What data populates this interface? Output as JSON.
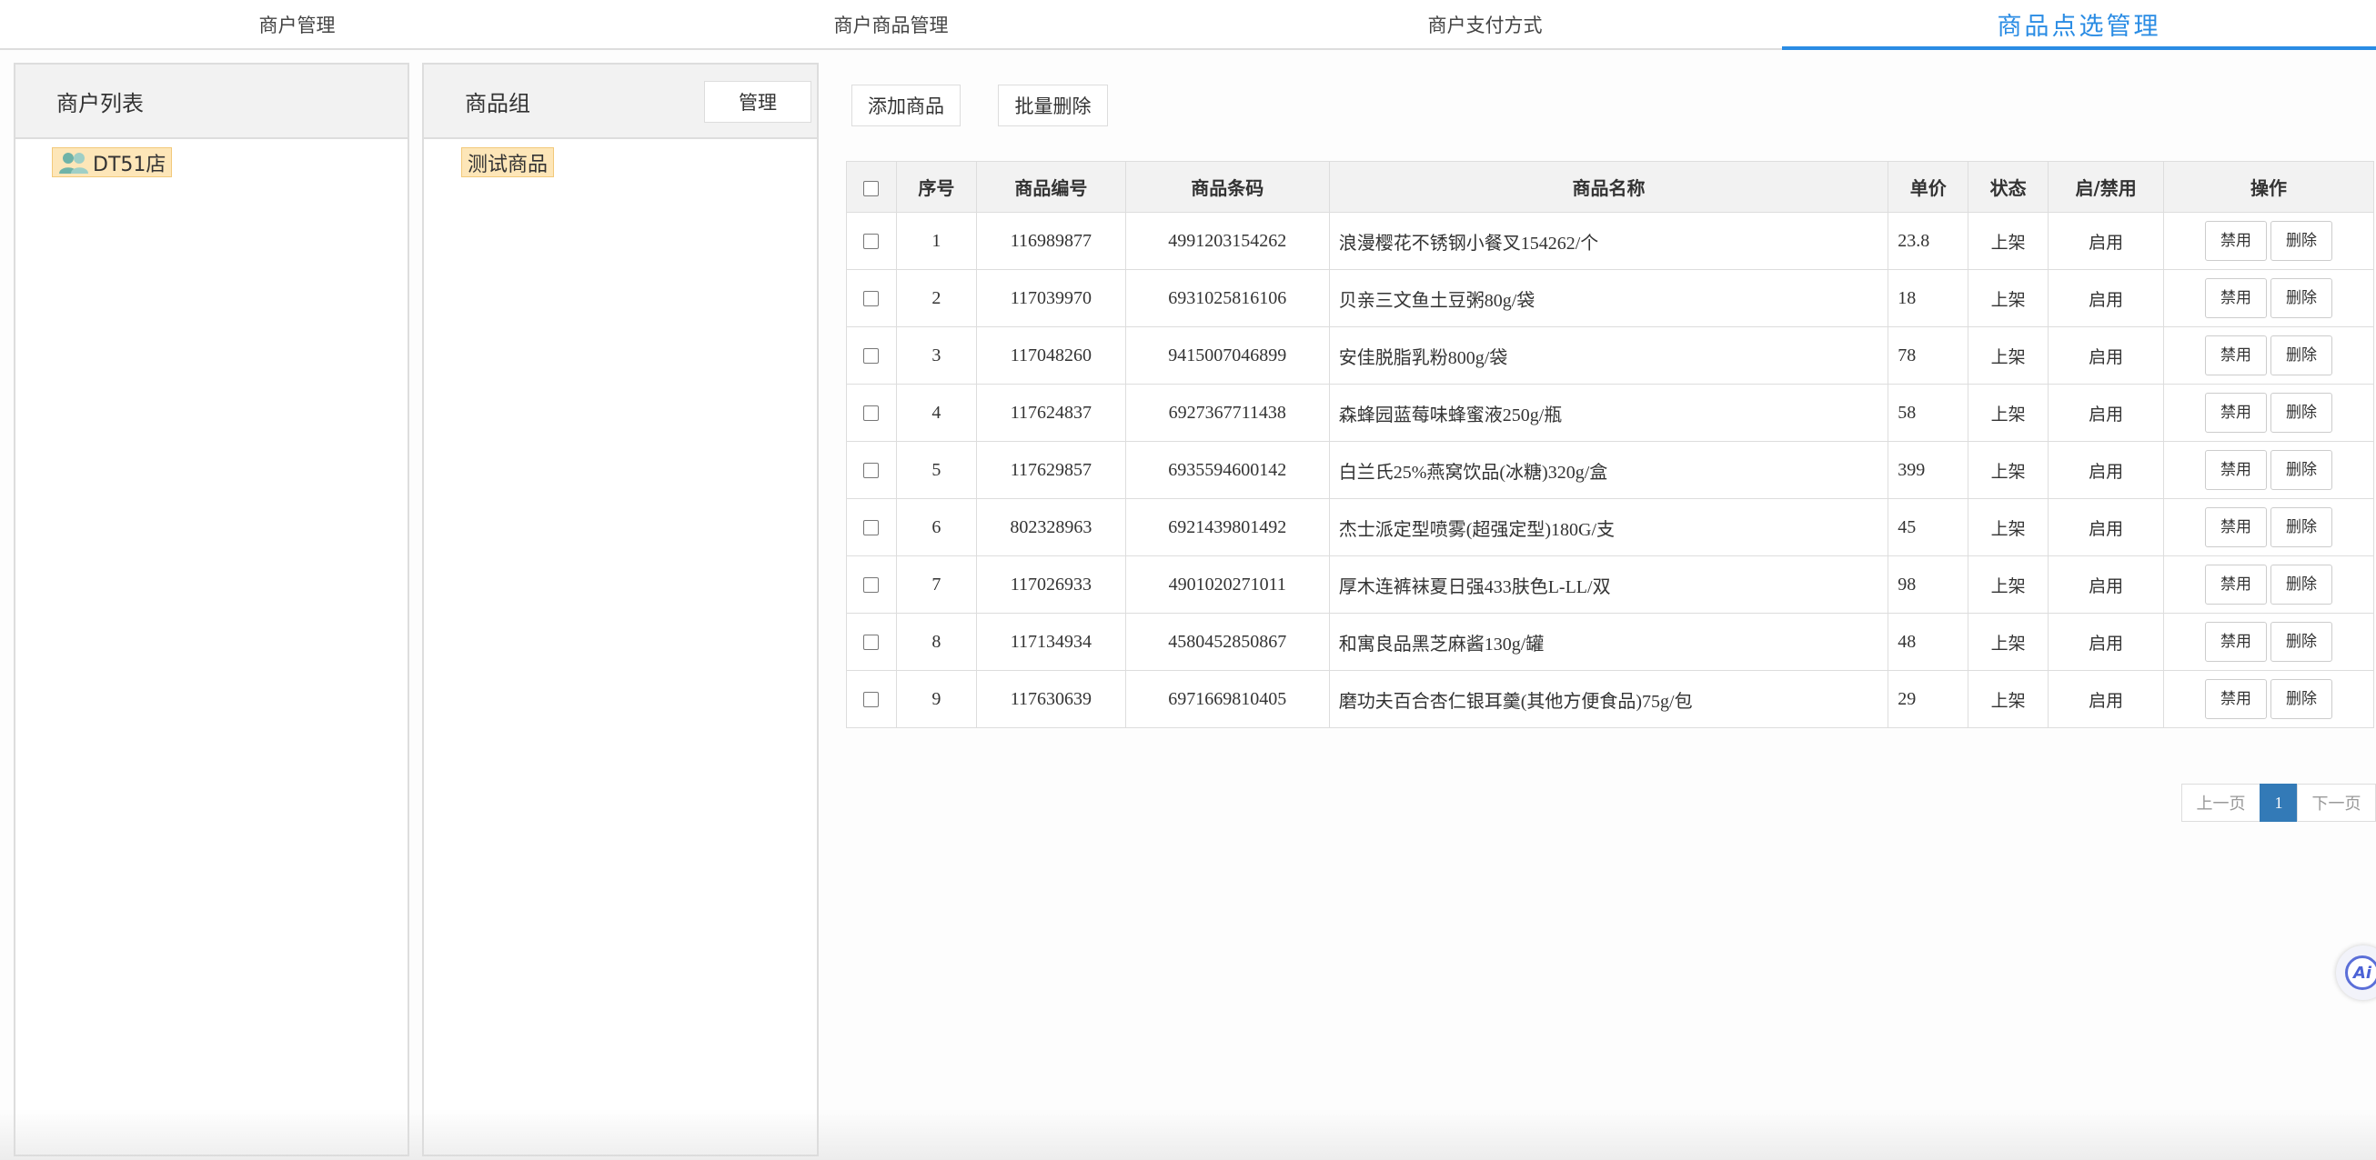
{
  "tabs": [
    {
      "label": "商户管理",
      "active": false
    },
    {
      "label": "商户商品管理",
      "active": false
    },
    {
      "label": "商户支付方式",
      "active": false
    },
    {
      "label": "商品点选管理",
      "active": true
    }
  ],
  "merchant_panel": {
    "title": "商户列表",
    "items": [
      {
        "label": "DT51店",
        "icon": "users-icon"
      }
    ]
  },
  "group_panel": {
    "title": "商品组",
    "manage_label": "管理",
    "items": [
      {
        "label": "测试商品"
      }
    ]
  },
  "toolbar": {
    "add_label": "添加商品",
    "batch_delete_label": "批量删除"
  },
  "table": {
    "columns": [
      "序号",
      "商品编号",
      "商品条码",
      "商品名称",
      "单价",
      "状态",
      "启/禁用",
      "操作"
    ],
    "action_disable": "禁用",
    "action_delete": "删除",
    "rows": [
      {
        "seq": "1",
        "code": "116989877",
        "barcode": "4991203154262",
        "name": "浪漫樱花不锈钢小餐叉154262/个",
        "price": "23.8",
        "status": "上架",
        "enabled": "启用"
      },
      {
        "seq": "2",
        "code": "117039970",
        "barcode": "6931025816106",
        "name": "贝亲三文鱼土豆粥80g/袋",
        "price": "18",
        "status": "上架",
        "enabled": "启用"
      },
      {
        "seq": "3",
        "code": "117048260",
        "barcode": "9415007046899",
        "name": "安佳脱脂乳粉800g/袋",
        "price": "78",
        "status": "上架",
        "enabled": "启用"
      },
      {
        "seq": "4",
        "code": "117624837",
        "barcode": "6927367711438",
        "name": "森蜂园蓝莓味蜂蜜液250g/瓶",
        "price": "58",
        "status": "上架",
        "enabled": "启用"
      },
      {
        "seq": "5",
        "code": "117629857",
        "barcode": "6935594600142",
        "name": "白兰氏25%燕窝饮品(冰糖)320g/盒",
        "price": "399",
        "status": "上架",
        "enabled": "启用"
      },
      {
        "seq": "6",
        "code": "802328963",
        "barcode": "6921439801492",
        "name": "杰士派定型喷雾(超强定型)180G/支",
        "price": "45",
        "status": "上架",
        "enabled": "启用"
      },
      {
        "seq": "7",
        "code": "117026933",
        "barcode": "4901020271011",
        "name": "厚木连裤袜夏日强433肤色L-LL/双",
        "price": "98",
        "status": "上架",
        "enabled": "启用"
      },
      {
        "seq": "8",
        "code": "117134934",
        "barcode": "4580452850867",
        "name": "和寓良品黑芝麻酱130g/罐",
        "price": "48",
        "status": "上架",
        "enabled": "启用"
      },
      {
        "seq": "9",
        "code": "117630639",
        "barcode": "6971669810405",
        "name": "磨功夫百合杏仁银耳羹(其他方便食品)75g/包",
        "price": "29",
        "status": "上架",
        "enabled": "启用"
      }
    ]
  },
  "pagination": {
    "prev_label": "上一页",
    "current": "1",
    "next_label": "下一页"
  },
  "ai_button": {
    "label": "Ai",
    "icon": "ai-assistant-icon"
  },
  "colors": {
    "accent": "#2a8ce4",
    "page_active": "#337ab7",
    "highlight": "#fde6b8"
  }
}
